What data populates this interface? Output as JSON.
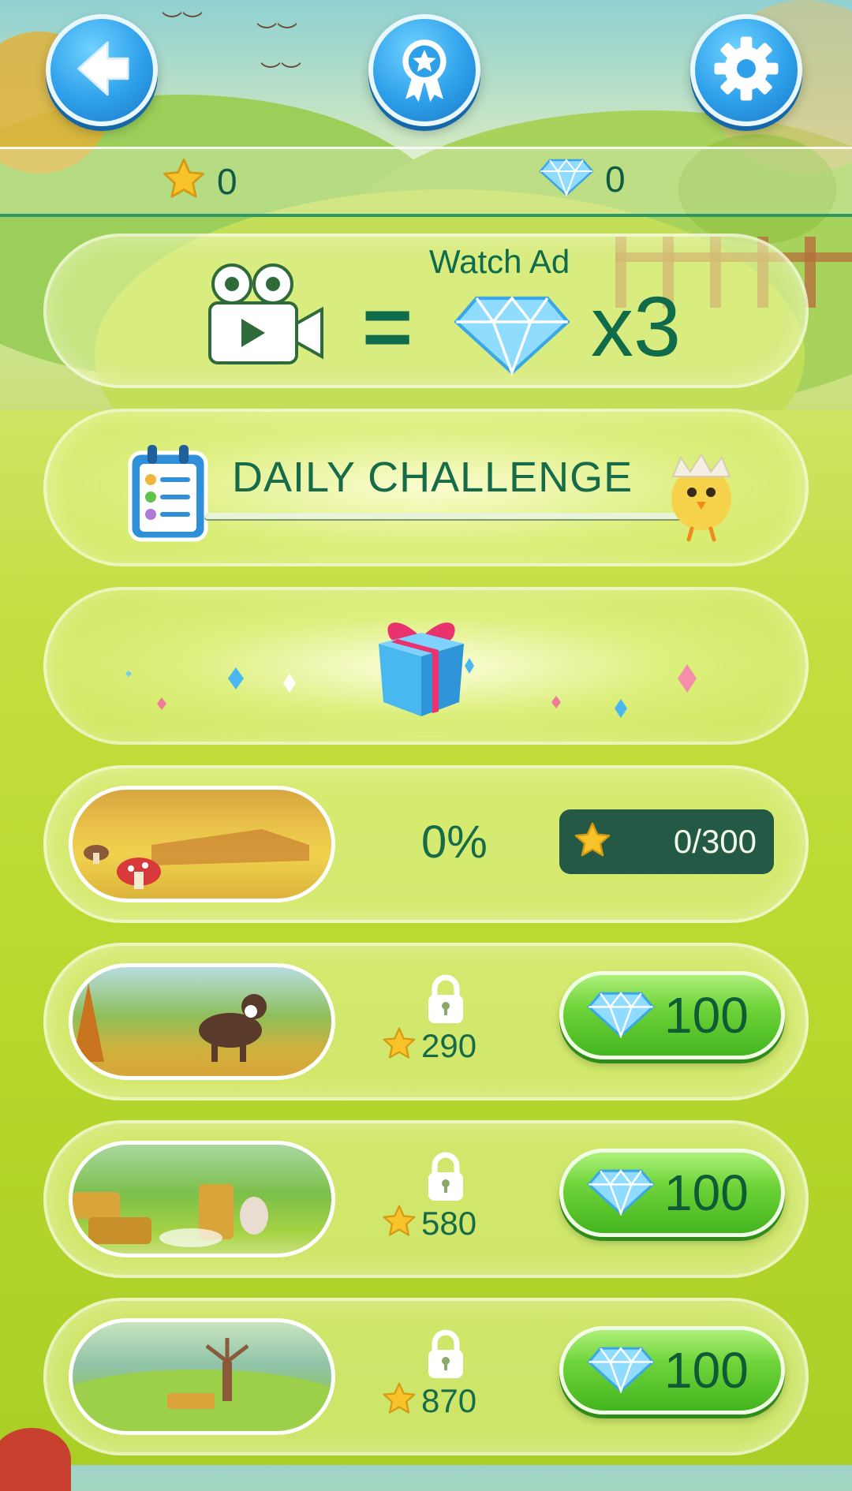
{
  "top_bar": {
    "back_icon": "back-arrow-icon",
    "achievements_icon": "award-ribbon-icon",
    "settings_icon": "gear-icon"
  },
  "currency": {
    "stars": "0",
    "diamonds": "0"
  },
  "watch_ad": {
    "label": "Watch Ad",
    "equals": "=",
    "multiplier": "x3"
  },
  "daily_challenge": {
    "title": "DAILY CHALLENGE"
  },
  "levels": [
    {
      "progress": "0%",
      "stars": "0/300"
    },
    {
      "required_stars": "290",
      "price": "100"
    },
    {
      "required_stars": "580",
      "price": "100"
    },
    {
      "required_stars": "870",
      "price": "100"
    }
  ],
  "colors": {
    "text_green": "#166b49",
    "blue_button": "#2ea0ea",
    "green_button": "#6fd43a",
    "pill_dark": "#245a45"
  }
}
